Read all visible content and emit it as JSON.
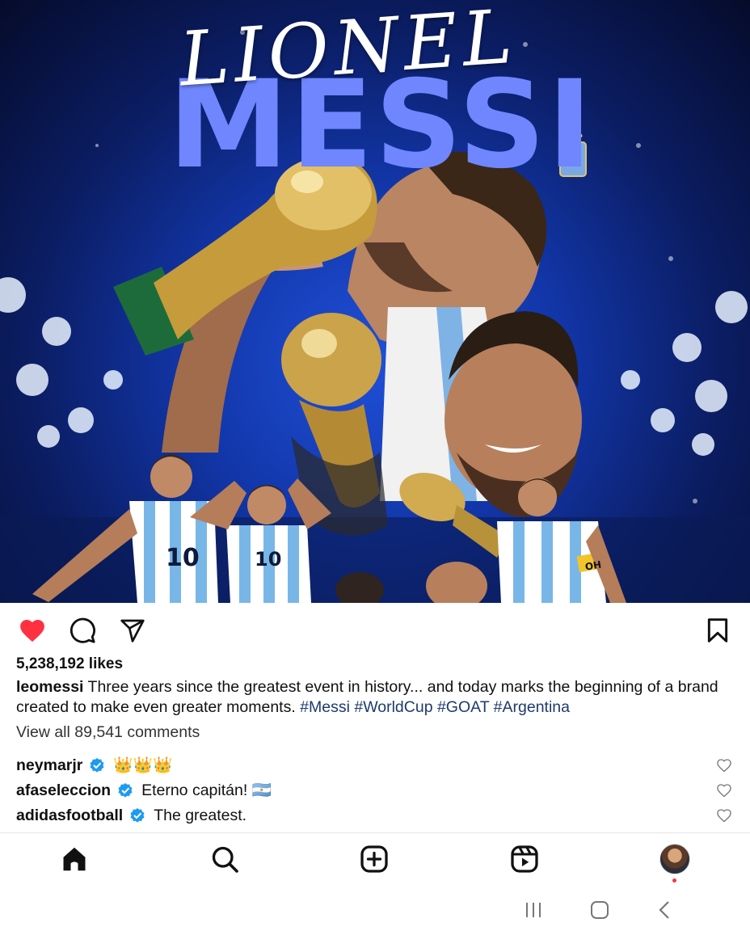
{
  "post": {
    "image": {
      "script_title": "LIONEL",
      "main_title": "MESSI",
      "shirt_number": "10",
      "armband_text": "OH",
      "accent_color": "#6f86ff"
    },
    "liked": true,
    "likes_text": "5,238,192 likes",
    "caption": {
      "username": "leomessi",
      "text": "Three years since the greatest event in history... and today marks the  beginning of a brand created to make even greater moments. ",
      "hashtags": "#Messi #WorldCup #GOAT #Argentina"
    },
    "view_comments_text": "View all 89,541 comments",
    "comments": [
      {
        "username": "neymarjr",
        "verified": true,
        "text": "👑👑👑"
      },
      {
        "username": "afaseleccion",
        "verified": true,
        "text": "Eterno capitán! 🇦🇷"
      },
      {
        "username": "adidasfootball",
        "verified": true,
        "text": "The greatest."
      }
    ]
  },
  "icons": {
    "like": "heart-icon",
    "comment": "comment-icon",
    "share": "send-icon",
    "save": "bookmark-icon"
  },
  "bottom_nav": [
    "home-icon",
    "search-icon",
    "create-icon",
    "reels-icon",
    "profile-avatar"
  ],
  "system_nav": [
    "recent-apps-icon",
    "home-button-icon",
    "back-icon"
  ],
  "colors": {
    "like_red": "#ff3040",
    "verified_blue": "#1d9bf0",
    "hashtag": "#1e3a6e"
  }
}
